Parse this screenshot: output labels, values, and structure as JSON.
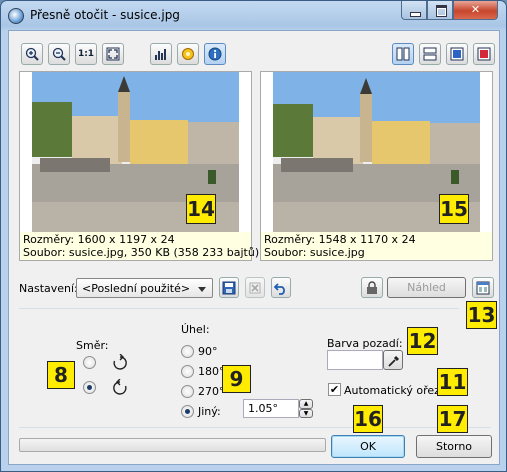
{
  "window": {
    "title": "Přesně otočit - susice.jpg"
  },
  "toolbar": {
    "left_icons": [
      "zoom-in-icon",
      "zoom-out-icon",
      "actual-size-icon",
      "fit-window-icon",
      "histogram-icon",
      "color-settings-icon",
      "info-icon"
    ],
    "actual_size_label": "1:1",
    "right_icons": [
      "layout-side-by-side-icon",
      "layout-stacked-icon",
      "layout-single-blue-icon",
      "layout-single-red-icon"
    ]
  },
  "left_preview": {
    "dimensions": "Rozměry: 1600 x 1197 x 24",
    "file": "Soubor: susice.jpg, 350 KB (358 233 bajtů)",
    "marker": "14"
  },
  "right_preview": {
    "dimensions": "Rozměry: 1548 x 1170 x 24",
    "file": "Soubor: susice.jpg",
    "marker": "15"
  },
  "settings": {
    "label": "Nastavení:",
    "preset_value": "<Poslední použité>",
    "preview_button": "Náhled",
    "marker_13": "13"
  },
  "direction": {
    "label": "Směr:",
    "options": [
      "clockwise",
      "counterclockwise"
    ],
    "selected": "counterclockwise",
    "marker": "8"
  },
  "angle": {
    "label": "Úhel:",
    "options": [
      "90°",
      "180°",
      "270°",
      "Jiný:"
    ],
    "selected": "Jiný:",
    "custom_value": "1.05°",
    "marker": "9"
  },
  "background": {
    "label": "Barva pozadí:",
    "marker": "12"
  },
  "auto_crop": {
    "label": "Automatický ořez",
    "checked": true,
    "marker": "11"
  },
  "footer": {
    "ok_label": "OK",
    "cancel_label": "Storno",
    "marker_ok": "16",
    "marker_cancel": "17"
  }
}
